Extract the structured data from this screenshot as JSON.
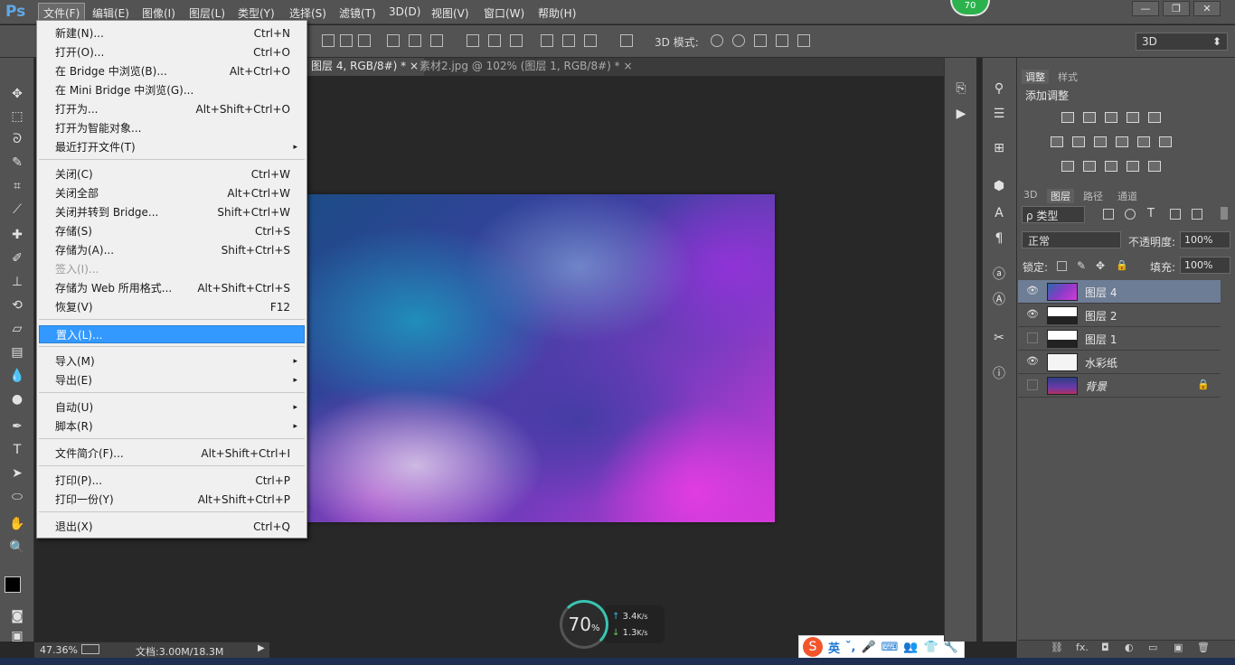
{
  "app": {
    "logo": "Ps",
    "badge": "70"
  },
  "menubar": {
    "items": [
      "文件(F)",
      "编辑(E)",
      "图像(I)",
      "图层(L)",
      "类型(Y)",
      "选择(S)",
      "滤镜(T)",
      "3D(D)",
      "视图(V)",
      "窗口(W)",
      "帮助(H)"
    ]
  },
  "window_controls": {
    "minimize": "—",
    "restore": "❐",
    "close": "✕"
  },
  "options": {
    "mode3d_label": "3D 模式:",
    "workspace": "3D",
    "workspace_arrow": "⬍"
  },
  "tabs": [
    {
      "label": "图层 4, RGB/8#) *",
      "close": "×"
    },
    {
      "label": "素材2.jpg @ 102% (图层 1, RGB/8#) *",
      "close": "×"
    }
  ],
  "file_menu": {
    "items": [
      {
        "label": "新建(N)...",
        "shortcut": "Ctrl+N"
      },
      {
        "label": "打开(O)...",
        "shortcut": "Ctrl+O"
      },
      {
        "label": "在 Bridge 中浏览(B)...",
        "shortcut": "Alt+Ctrl+O"
      },
      {
        "label": "在 Mini Bridge 中浏览(G)...",
        "shortcut": ""
      },
      {
        "label": "打开为...",
        "shortcut": "Alt+Shift+Ctrl+O"
      },
      {
        "label": "打开为智能对象...",
        "shortcut": ""
      },
      {
        "label": "最近打开文件(T)",
        "shortcut": "",
        "submenu": true
      },
      {
        "label": "关闭(C)",
        "shortcut": "Ctrl+W"
      },
      {
        "label": "关闭全部",
        "shortcut": "Alt+Ctrl+W"
      },
      {
        "label": "关闭并转到 Bridge...",
        "shortcut": "Shift+Ctrl+W"
      },
      {
        "label": "存储(S)",
        "shortcut": "Ctrl+S"
      },
      {
        "label": "存储为(A)...",
        "shortcut": "Shift+Ctrl+S"
      },
      {
        "label": "签入(I)...",
        "shortcut": "",
        "disabled": true
      },
      {
        "label": "存储为 Web 所用格式...",
        "shortcut": "Alt+Shift+Ctrl+S"
      },
      {
        "label": "恢复(V)",
        "shortcut": "F12"
      },
      {
        "label": "置入(L)...",
        "shortcut": "",
        "highlighted": true
      },
      {
        "label": "导入(M)",
        "shortcut": "",
        "submenu": true
      },
      {
        "label": "导出(E)",
        "shortcut": "",
        "submenu": true
      },
      {
        "label": "自动(U)",
        "shortcut": "",
        "submenu": true
      },
      {
        "label": "脚本(R)",
        "shortcut": "",
        "submenu": true
      },
      {
        "label": "文件简介(F)...",
        "shortcut": "Alt+Shift+Ctrl+I"
      },
      {
        "label": "打印(P)...",
        "shortcut": "Ctrl+P"
      },
      {
        "label": "打印一份(Y)",
        "shortcut": "Alt+Shift+Ctrl+P"
      },
      {
        "label": "退出(X)",
        "shortcut": "Ctrl+Q"
      }
    ],
    "submenu_arrow": "▸"
  },
  "status": {
    "zoom": "47.36%",
    "doc": "文档:3.00M/18.3M"
  },
  "net": {
    "percent": "70",
    "percent_sign": "%",
    "up": "3.4",
    "down": "1.3",
    "unit": "K/s",
    "up_arrow": "↑",
    "down_arrow": "↓"
  },
  "ime": {
    "logo": "S",
    "mode": "英",
    "punct": "ˇ,",
    "mic": "🎤",
    "kbd": "⌨",
    "user": "👥",
    "shirt": "👕",
    "tool": "🔧"
  },
  "right_panel": {
    "adj_tabs": [
      "调整",
      "样式"
    ],
    "adj_title": "添加调整",
    "layer_tabs": [
      "3D",
      "图层",
      "路径",
      "通道"
    ],
    "filter": "ρ 类型",
    "blend": "正常",
    "opacity_label": "不透明度:",
    "opacity": "100%",
    "lock_label": "锁定:",
    "fill_label": "填充:",
    "fill": "100%",
    "layers": [
      {
        "name": "图层 4",
        "visible": true,
        "selected": true
      },
      {
        "name": "图层 2",
        "visible": true
      },
      {
        "name": "图层 1",
        "visible": false
      },
      {
        "name": "水彩纸",
        "visible": true
      },
      {
        "name": "背景",
        "visible": false,
        "locked": true
      }
    ],
    "footer": [
      "⛓",
      "fx.",
      "◘",
      "◐",
      "▭",
      "▣",
      "🗑"
    ]
  },
  "icons": {
    "eye": "👁",
    "lock": "🔒",
    "dropdown": "⬍"
  }
}
